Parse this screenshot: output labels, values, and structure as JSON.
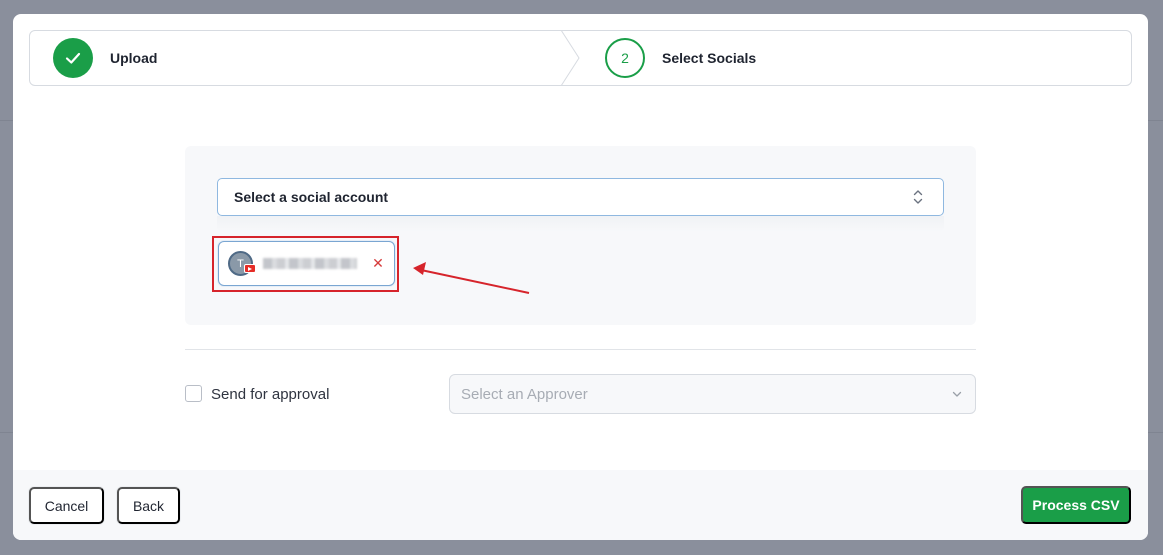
{
  "stepper": {
    "steps": [
      {
        "label": "Upload",
        "state": "completed",
        "icon": "check-icon"
      },
      {
        "label": "Select Socials",
        "state": "current",
        "number": "2"
      }
    ]
  },
  "social_account": {
    "placeholder": "Select a social account",
    "icon": "updown-chevron-icon",
    "selected_chip": {
      "avatar_initial": "T",
      "platform_icon": "youtube-icon",
      "name": "",
      "remove_icon": "close-icon"
    }
  },
  "approval": {
    "checkbox_label": "Send for approval",
    "checked": false,
    "approver_placeholder": "Select an Approver"
  },
  "footer": {
    "cancel_label": "Cancel",
    "back_label": "Back",
    "process_label": "Process CSV"
  },
  "colors": {
    "accent_green": "#1a9e48",
    "annotation_red": "#d6242b",
    "youtube_red": "#e52d27"
  }
}
